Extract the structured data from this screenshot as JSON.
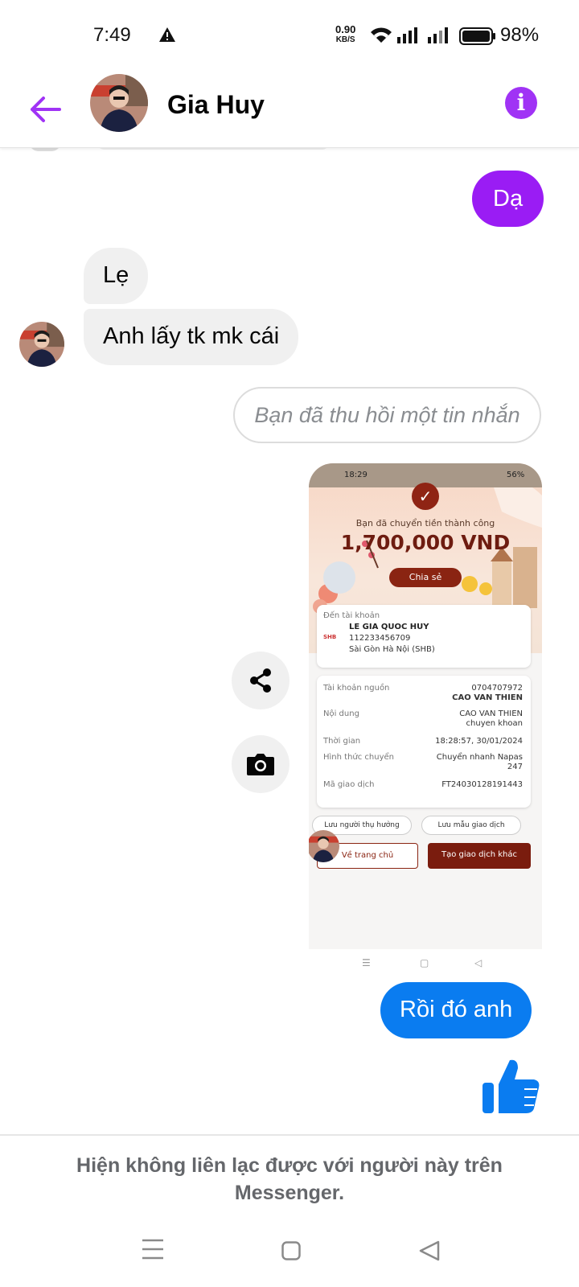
{
  "status_bar": {
    "time": "7:49",
    "net_speed_value": "0.90",
    "net_speed_unit": "KB/S",
    "battery_pct": "98%",
    "icons": [
      "warning-icon",
      "wifi-icon",
      "signal-icon",
      "signal-icon",
      "battery-icon"
    ]
  },
  "header": {
    "contact_name": "Gia Huy",
    "back_icon": "arrow-left-icon",
    "info_icon": "info-icon",
    "info_glyph": "i",
    "accent_color": "#a033f5"
  },
  "messages": {
    "outgoing_1": "Dạ",
    "incoming_1": "Lẹ",
    "incoming_2": "Anh lấy tk mk cái",
    "recalled": "Bạn đã thu hồi một tin nhắn",
    "outgoing_2": "Rồi đó anh",
    "like_icon": "thumbs-up-icon"
  },
  "receipt_image": {
    "status_time": "18:29",
    "status_battery": "56%",
    "check_glyph": "✓",
    "subtitle": "Bạn đã chuyển tiền thành công",
    "amount": "1,700,000 VND",
    "share_label": "Chia sẻ",
    "to_account_label": "Đến tài khoản",
    "recipient_name": "LE GIA QUOC HUY",
    "recipient_account": "112233456709",
    "recipient_bank": "Sài Gòn Hà Nội (SHB)",
    "bank_logo_text": "SHB",
    "rows": [
      {
        "label": "Tài khoản nguồn",
        "value_1": "0704707972",
        "value_2": "CAO VAN THIEN"
      },
      {
        "label": "Nội dung",
        "value_1": "CAO VAN THIEN",
        "value_2": "chuyen khoan"
      },
      {
        "label": "Thời gian",
        "value_1": "18:28:57, 30/01/2024",
        "value_2": ""
      },
      {
        "label": "Hình thức chuyển",
        "value_1": "Chuyển nhanh Napas",
        "value_2": "247"
      },
      {
        "label": "Mã giao dịch",
        "value_1": "FT24030128191443",
        "value_2": ""
      }
    ],
    "save_recipient": "Lưu người thụ hưởng",
    "save_template": "Lưu mẫu giao dịch",
    "home_button": "Về trang chủ",
    "new_transaction_button": "Tạo giao dịch khác",
    "nav_menu_glyph": "☰",
    "nav_home_glyph": "▢",
    "nav_back_glyph": "◁"
  },
  "footer": {
    "notice": "Hiện không liên lạc được với người này trên Messenger."
  },
  "colors": {
    "outgoing_purple": "#9a1cf4",
    "outgoing_blue": "#0a7cf0",
    "incoming_grey": "#f0f0f0"
  }
}
